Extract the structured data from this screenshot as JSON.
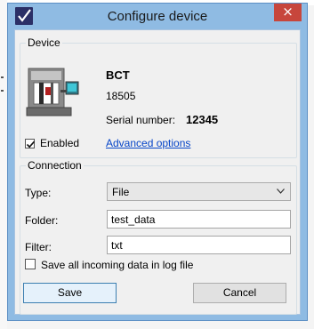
{
  "window": {
    "title": "Configure device",
    "close_label": "×",
    "app_icon": "checkmark-app-icon"
  },
  "device": {
    "group_label": "Device",
    "image": "benchtop-device-icon",
    "name": "BCT",
    "model": "18505",
    "serial_label": "Serial number:",
    "serial_value": "12345",
    "enabled_label": "Enabled",
    "enabled_checked": true,
    "advanced_link": "Advanced options"
  },
  "connection": {
    "group_label": "Connection",
    "type_label": "Type:",
    "type_value": "File",
    "folder_label": "Folder:",
    "folder_value": "test_data",
    "filter_label": "Filter:",
    "filter_value": "txt",
    "save_all_label": "Save all incoming data in log file",
    "save_all_checked": false
  },
  "buttons": {
    "save": "Save",
    "cancel": "Cancel"
  },
  "colors": {
    "title_bar": "#8fbbe3",
    "close_button": "#c7463c",
    "link": "#0645c8",
    "default_button_border": "#3c7fb1"
  }
}
